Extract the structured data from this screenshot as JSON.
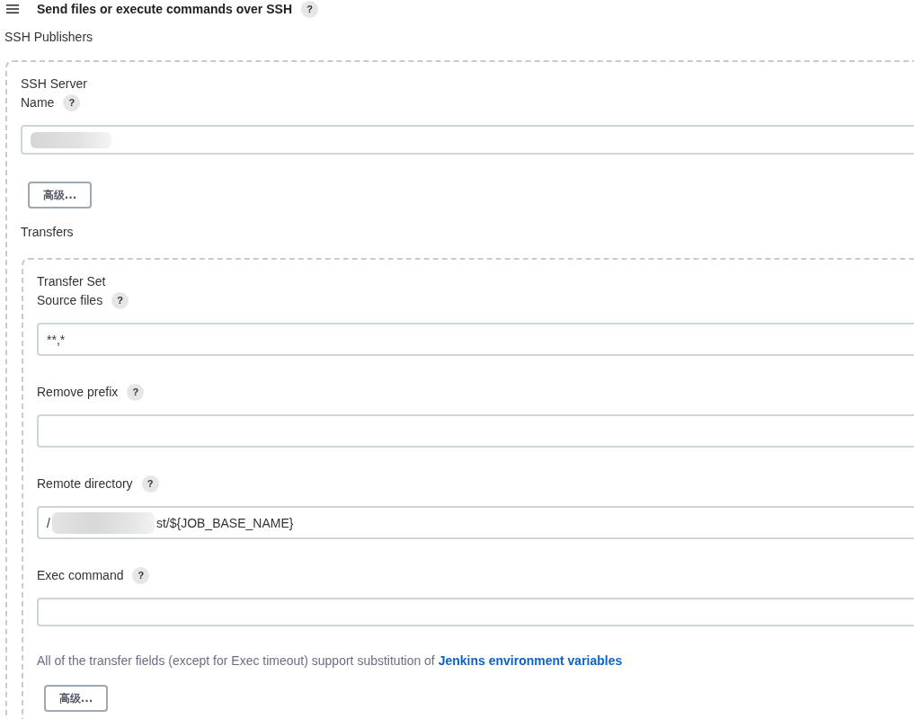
{
  "section": {
    "title": "Send files or execute commands over SSH",
    "help": "?"
  },
  "publishers": {
    "label": "SSH Publishers"
  },
  "server": {
    "title": "SSH Server",
    "fields": [
      {
        "label": "Name",
        "help": "?",
        "redacted": true
      }
    ],
    "advanced_button": "高级..."
  },
  "transfers": {
    "label": "Transfers",
    "transfer_set": {
      "title": "Transfer Set",
      "fields": [
        {
          "label": "Source files",
          "help": "?",
          "value": "**,*",
          "redacted": false
        },
        {
          "label": "Remove prefix",
          "help": "?",
          "redacted": false
        },
        {
          "label": "Remote directory",
          "help": "?",
          "value": "/",
          "redacted": true,
          "value_after": "st/${JOB_BASE_NAME}"
        },
        {
          "label": "Exec command",
          "help": "?",
          "redacted": false
        }
      ],
      "note": {
        "text": "All of the transfer fields (except for Exec timeout) support substitution of",
        "link": "Jenkins environment variables"
      },
      "advanced_button": "高级..."
    }
  }
}
